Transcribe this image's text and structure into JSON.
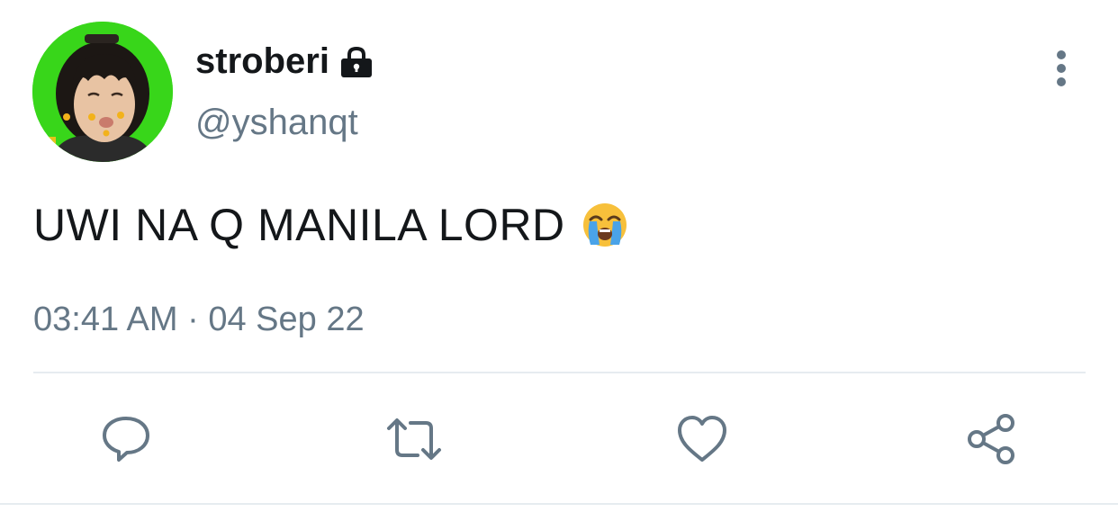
{
  "user": {
    "display_name": "stroberi",
    "handle": "@yshanqt",
    "avatar": "avatar-image",
    "lock_icon": "lock-icon"
  },
  "tweet": {
    "text": "UWI NA Q MANILA LORD",
    "emoji": "loudly-crying-face-emoji",
    "timestamp": "03:41 AM · 04 Sep 22"
  },
  "actions": [
    {
      "name": "reply",
      "icon": "reply-icon"
    },
    {
      "name": "retweet",
      "icon": "retweet-icon"
    },
    {
      "name": "like",
      "icon": "heart-icon"
    },
    {
      "name": "share",
      "icon": "share-icon"
    }
  ],
  "menu": {
    "icon": "more-vertical-icon"
  },
  "colors": {
    "primary_text": "#14171a",
    "secondary_text": "#657786",
    "icon": "#657786",
    "divider": "#e6ecf0",
    "avatar_background": "#38d61a"
  }
}
